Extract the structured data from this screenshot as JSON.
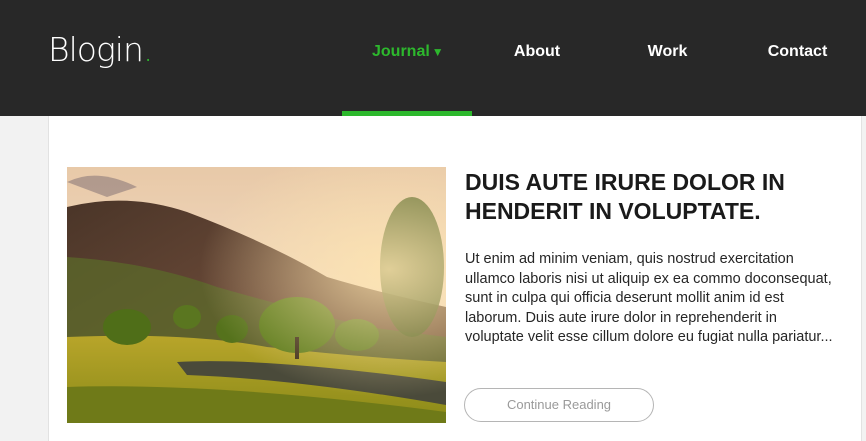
{
  "brand": {
    "name": "Blogin"
  },
  "nav": {
    "items": [
      {
        "label": "Journal",
        "active": true,
        "has_dropdown": true
      },
      {
        "label": "About"
      },
      {
        "label": "Work"
      },
      {
        "label": "Contact"
      }
    ],
    "caret_icon": "caret-down-icon"
  },
  "post": {
    "title": "DUIS AUTE IRURE DOLOR IN HENDERIT IN VOLUPTATE.",
    "excerpt": "Ut enim ad minim veniam, quis nostrud exercitation ullamco laboris nisi ut aliquip ex ea commo doconsequat, sunt in culpa qui officia deserunt mollit anim id est laborum. Duis aute irure dolor in reprehenderit in voluptate velit esse cillum dolore eu fugiat nulla pariatur...",
    "button_label": "Continue Reading",
    "image": "landscape-hills-trees-stone-wall"
  },
  "colors": {
    "header_bg": "#282828",
    "accent": "#2db82d",
    "text": "#1a1a1a",
    "page_bg": "#f2f2f2"
  }
}
